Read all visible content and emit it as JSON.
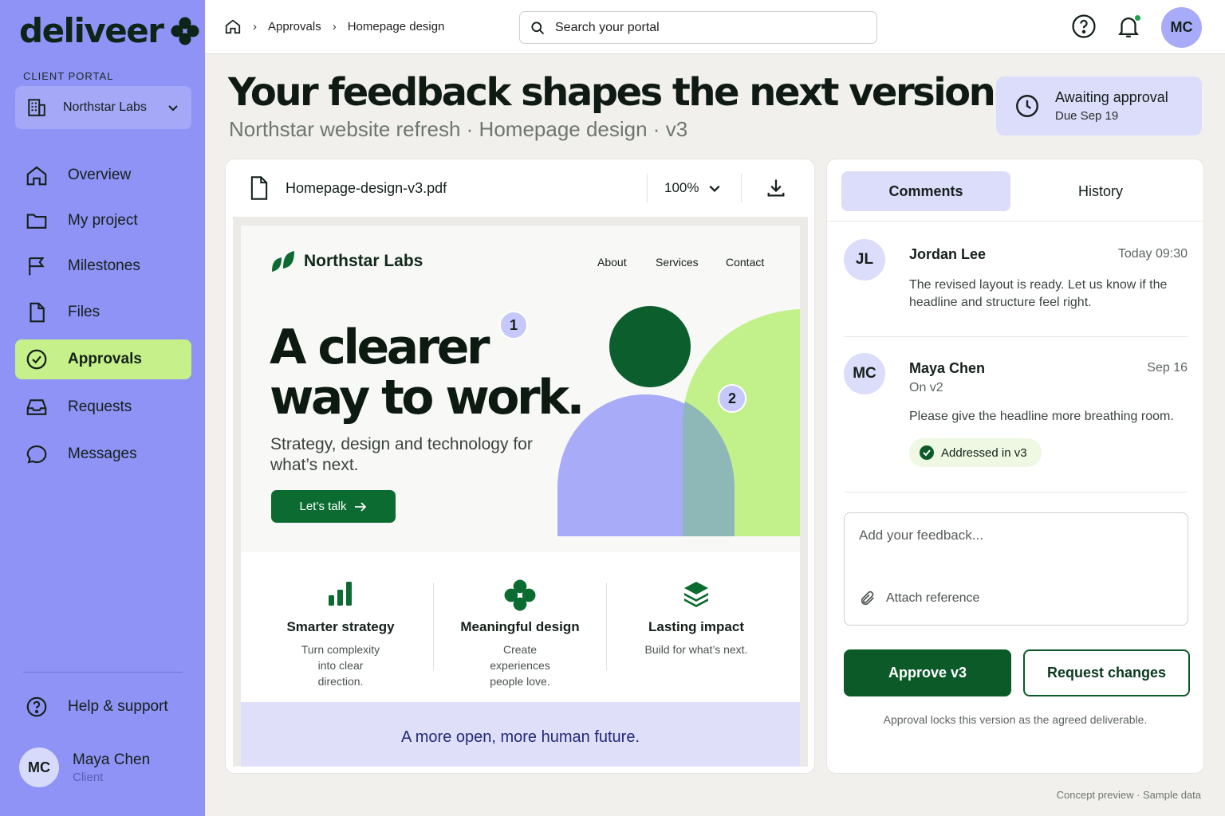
{
  "brand": {
    "logo_text": "deliveer",
    "accent": "#8e93f5",
    "active_green": "#c5f08a",
    "primary_green": "#0b5a28"
  },
  "sidebar": {
    "section_label": "CLIENT PORTAL",
    "client_select": {
      "value": "Northstar Labs",
      "icon": "building-icon"
    },
    "items": [
      {
        "label": "Overview",
        "icon": "home-icon"
      },
      {
        "label": "My project",
        "icon": "folder-icon"
      },
      {
        "label": "Milestones",
        "icon": "flag-icon"
      },
      {
        "label": "Files",
        "icon": "file-icon"
      },
      {
        "label": "Approvals",
        "icon": "check-circle-icon",
        "active": true
      },
      {
        "label": "Requests",
        "icon": "inbox-icon"
      },
      {
        "label": "Messages",
        "icon": "chat-icon"
      }
    ],
    "help": {
      "label": "Help & support",
      "icon": "help-circle-icon"
    },
    "user": {
      "initials": "MC",
      "name": "Maya Chen",
      "role": "Client"
    }
  },
  "header": {
    "breadcrumb": [
      "Approvals",
      "Homepage design"
    ],
    "search": {
      "placeholder": "Search your portal",
      "value": ""
    },
    "avatar_initials": "MC"
  },
  "page": {
    "title": "Your feedback shapes the next version.",
    "subtitle": "Northstar website refresh · Homepage design · v3",
    "status": {
      "label": "Awaiting approval",
      "due": "Due Sep 19"
    }
  },
  "document": {
    "file_name": "Homepage-design-v3.pdf",
    "zoom": "100%",
    "preview": {
      "brand": "Northstar Labs",
      "nav": [
        "About",
        "Services",
        "Contact"
      ],
      "hero_line1": "A clearer",
      "hero_line2": "way to work.",
      "hero_sub": "Strategy, design and technology for what’s next.",
      "cta": "Let’s talk",
      "markers": [
        "1",
        "2"
      ],
      "features": [
        {
          "title": "Smarter strategy",
          "desc": "Turn complexity into clear direction.",
          "icon": "bar-chart-icon"
        },
        {
          "title": "Meaningful design",
          "desc": "Create experiences people love.",
          "icon": "clover-icon"
        },
        {
          "title": "Lasting impact",
          "desc": "Build for what’s next.",
          "icon": "layers-icon"
        }
      ],
      "footer": "A more open, more human future."
    }
  },
  "comments_panel": {
    "tabs": [
      "Comments",
      "History"
    ],
    "comments": [
      {
        "initials": "JL",
        "author": "Jordan Lee",
        "time": "Today 09:30",
        "text": "The revised layout is ready. Let us know if the headline and structure feel right."
      },
      {
        "initials": "MC",
        "author": "Maya Chen",
        "time": "Sep 16",
        "version": "On v2",
        "text": "Please give the headline more breathing room.",
        "status": "Addressed in v3"
      }
    ],
    "feedback_placeholder": "Add your feedback...",
    "attach_label": "Attach reference",
    "approve_label": "Approve v3",
    "request_label": "Request changes",
    "approve_note": "Approval locks this version as the agreed deliverable."
  },
  "footer_note": "Concept preview · Sample data"
}
